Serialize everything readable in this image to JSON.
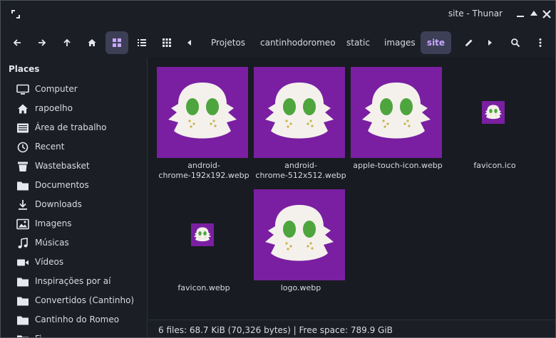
{
  "window": {
    "title": "site - Thunar"
  },
  "toolbar": {
    "breadcrumbs": [
      {
        "label": "Projetos"
      },
      {
        "label": "cantinhodoromeo"
      },
      {
        "label": "static"
      },
      {
        "label": "images"
      },
      {
        "label": "site",
        "active": true
      }
    ],
    "active_view": "icon-view"
  },
  "sidebar": {
    "section_title": "Places",
    "items": [
      {
        "label": "Computer",
        "icon": "computer-icon"
      },
      {
        "label": "rapoelho",
        "icon": "home-icon"
      },
      {
        "label": "Área de trabalho",
        "icon": "desktop-icon"
      },
      {
        "label": "Recent",
        "icon": "clock-icon"
      },
      {
        "label": "Wastebasket",
        "icon": "trash-icon"
      },
      {
        "label": "Documentos",
        "icon": "folder-icon"
      },
      {
        "label": "Downloads",
        "icon": "download-icon"
      },
      {
        "label": "Imagens",
        "icon": "image-icon"
      },
      {
        "label": "Músicas",
        "icon": "music-icon"
      },
      {
        "label": "Vídeos",
        "icon": "video-icon"
      },
      {
        "label": "Inspirações por aí",
        "icon": "folder-icon"
      },
      {
        "label": "Convertidos (Cantinho)",
        "icon": "folder-icon"
      },
      {
        "label": "Cantinho do Romeo",
        "icon": "folder-icon"
      },
      {
        "label": "Fi...",
        "icon": "folder-icon"
      }
    ]
  },
  "files": [
    {
      "name_line1": "android-",
      "name_line2": "chrome-192x192.webp",
      "thumb": "large"
    },
    {
      "name_line1": "android-",
      "name_line2": "chrome-512x512.webp",
      "thumb": "large"
    },
    {
      "name_line1": "apple-touch-icon.webp",
      "name_line2": "",
      "thumb": "large"
    },
    {
      "name_line1": "favicon.ico",
      "name_line2": "",
      "thumb": "small"
    },
    {
      "name_line1": "favicon.webp",
      "name_line2": "",
      "thumb": "small"
    },
    {
      "name_line1": "logo.webp",
      "name_line2": "",
      "thumb": "large"
    }
  ],
  "status": {
    "text": "6 files: 68.7 KiB (70,326 bytes)  |  Free space: 789.9 GiB"
  },
  "colors": {
    "accent": "#c9a7ff",
    "thumb_bg": "#7a1fa2",
    "face": "#f4f1ec",
    "eye": "#4ea53e"
  }
}
